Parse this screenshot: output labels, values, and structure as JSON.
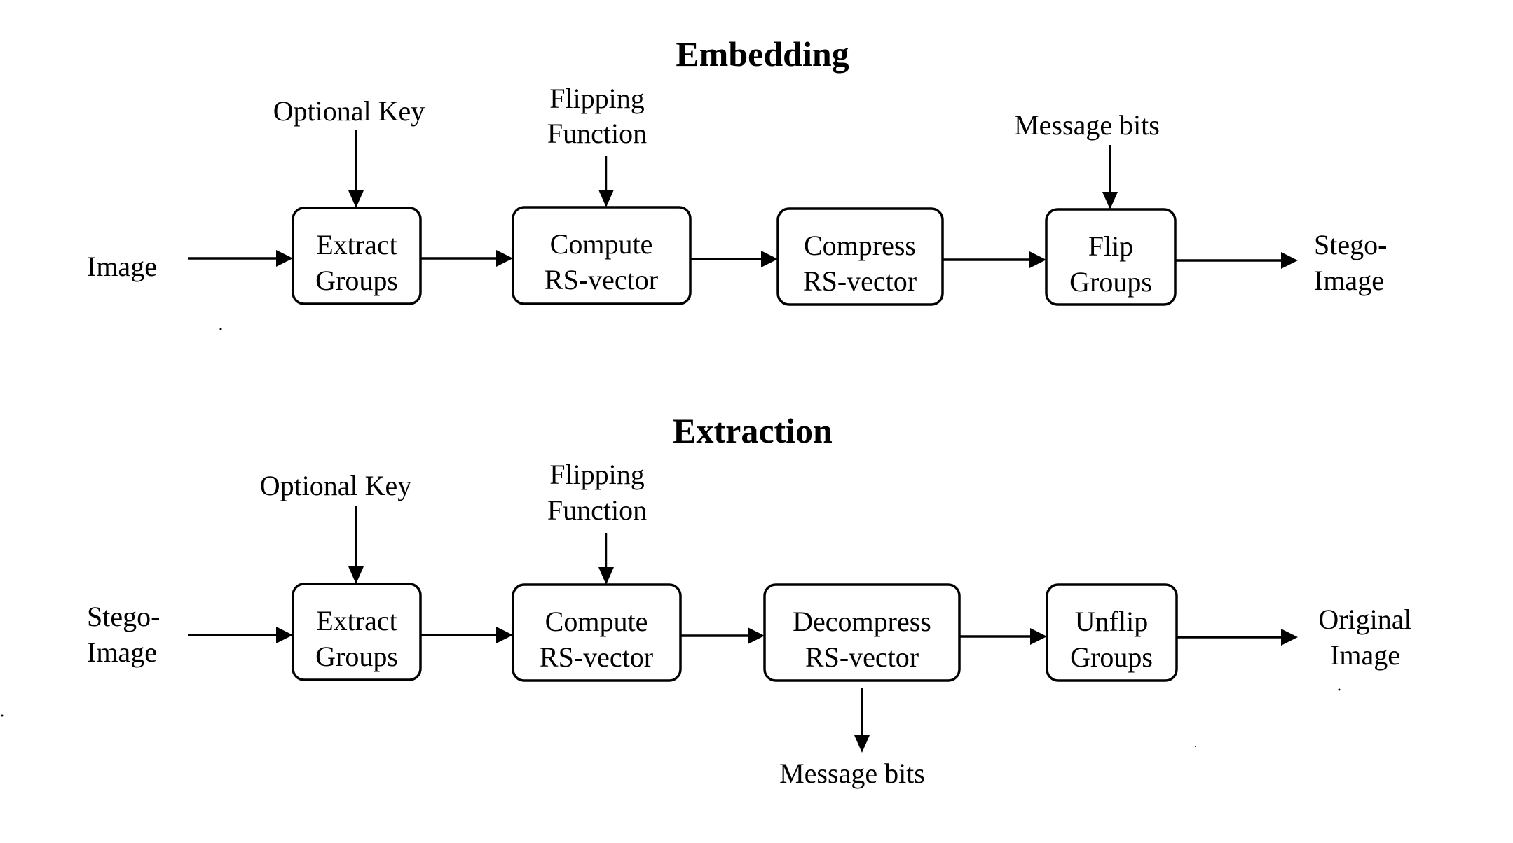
{
  "embedding": {
    "title": "Embedding",
    "input_label": [
      "Image"
    ],
    "output_label": [
      "Stego-",
      "Image"
    ],
    "boxes": [
      {
        "lines": [
          "Extract",
          "Groups"
        ]
      },
      {
        "lines": [
          "Compute",
          "RS-vector"
        ]
      },
      {
        "lines": [
          "Compress",
          "RS-vector"
        ]
      },
      {
        "lines": [
          "Flip",
          "Groups"
        ]
      }
    ],
    "side_inputs": [
      {
        "target_box": 0,
        "direction": "in",
        "lines": [
          "Optional Key"
        ]
      },
      {
        "target_box": 1,
        "direction": "in",
        "lines": [
          "Flipping",
          "Function"
        ]
      },
      {
        "target_box": 3,
        "direction": "in",
        "lines": [
          "Message bits"
        ]
      }
    ]
  },
  "extraction": {
    "title": "Extraction",
    "input_label": [
      "Stego-",
      "Image"
    ],
    "output_label": [
      "Original",
      "Image"
    ],
    "boxes": [
      {
        "lines": [
          "Extract",
          "Groups"
        ]
      },
      {
        "lines": [
          "Compute",
          "RS-vector"
        ]
      },
      {
        "lines": [
          "Decompress",
          "RS-vector"
        ]
      },
      {
        "lines": [
          "Unflip",
          "Groups"
        ]
      }
    ],
    "side_inputs": [
      {
        "target_box": 0,
        "direction": "in",
        "lines": [
          "Optional Key"
        ]
      },
      {
        "target_box": 1,
        "direction": "in",
        "lines": [
          "Flipping",
          "Function"
        ]
      },
      {
        "target_box": 2,
        "direction": "out",
        "lines": [
          "Message bits"
        ]
      }
    ]
  }
}
